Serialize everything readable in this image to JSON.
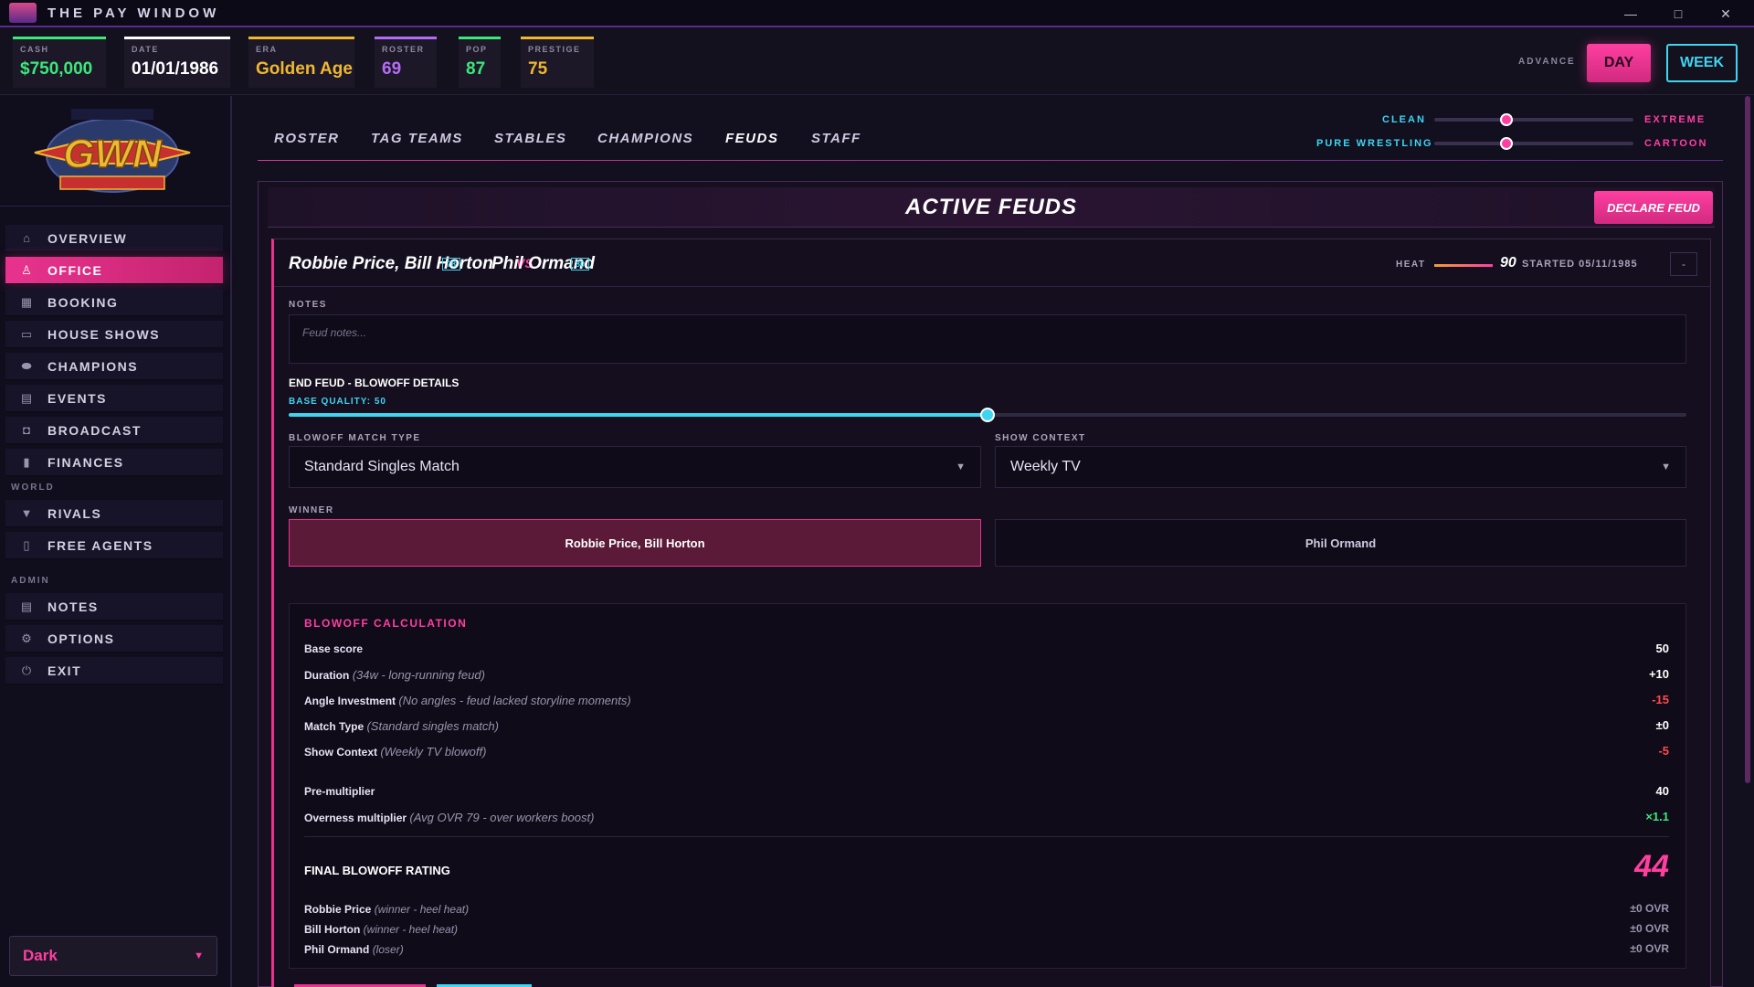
{
  "window": {
    "title": "THE PAY WINDOW",
    "minimize": "—",
    "maximize": "□",
    "close": "✕"
  },
  "stats": [
    {
      "label": "CASH",
      "value": "$750,000",
      "color": "#3ce87a"
    },
    {
      "label": "DATE",
      "value": "01/01/1986",
      "color": "#ffffff"
    },
    {
      "label": "ERA",
      "value": "Golden Age",
      "color": "#f0b830"
    },
    {
      "label": "ROSTER",
      "value": "69",
      "color": "#b56cf5"
    },
    {
      "label": "POP",
      "value": "87",
      "color": "#3ce87a"
    },
    {
      "label": "PRESTIGE",
      "value": "75",
      "color": "#f0b830"
    }
  ],
  "advance": {
    "label": "ADVANCE",
    "day": "DAY",
    "week": "WEEK"
  },
  "sidebar": {
    "items": [
      {
        "label": "OVERVIEW",
        "icon": "home-icon",
        "glyph": "⌂"
      },
      {
        "label": "OFFICE",
        "icon": "user-icon",
        "glyph": "♙",
        "active": true
      },
      {
        "label": "BOOKING",
        "icon": "calendar-icon",
        "glyph": "▦"
      },
      {
        "label": "HOUSE SHOWS",
        "icon": "ticket-icon",
        "glyph": "▭"
      },
      {
        "label": "CHAMPIONS",
        "icon": "belt-icon",
        "glyph": "⬬"
      },
      {
        "label": "EVENTS",
        "icon": "screen-icon",
        "glyph": "▤"
      },
      {
        "label": "BROADCAST",
        "icon": "camera-icon",
        "glyph": "◘"
      },
      {
        "label": "FINANCES",
        "icon": "chart-icon",
        "glyph": "▮"
      }
    ],
    "world_label": "WORLD",
    "world_items": [
      {
        "label": "RIVALS",
        "icon": "shield-icon",
        "glyph": "▼"
      },
      {
        "label": "FREE AGENTS",
        "icon": "document-icon",
        "glyph": "▯"
      }
    ],
    "admin_label": "ADMIN",
    "admin_items": [
      {
        "label": "NOTES",
        "icon": "notes-icon",
        "glyph": "▤"
      },
      {
        "label": "OPTIONS",
        "icon": "gear-icon",
        "glyph": "⚙"
      },
      {
        "label": "EXIT",
        "icon": "power-icon",
        "glyph": "⏻"
      }
    ],
    "theme": {
      "value": "Dark",
      "chevron": "▼"
    }
  },
  "tabs": [
    {
      "label": "ROSTER"
    },
    {
      "label": "TAG TEAMS"
    },
    {
      "label": "STABLES"
    },
    {
      "label": "CHAMPIONS"
    },
    {
      "label": "FEUDS",
      "active": true
    },
    {
      "label": "STAFF"
    }
  ],
  "style_sliders": [
    {
      "left": "CLEAN",
      "right": "EXTREME",
      "value": 0.33
    },
    {
      "left": "PURE WRESTLING",
      "right": "CARTOON",
      "value": 0.33
    }
  ],
  "feuds": {
    "title": "ACTIVE FEUDS",
    "declare_label": "DECLARE FEUD",
    "feud": {
      "side_a": "Robbie Price, Bill Horton",
      "side_a_ovr": "78",
      "vs": "VS",
      "side_b": "Phil Ormand",
      "side_b_ovr": "80",
      "heat_label": "HEAT",
      "heat": "90",
      "started": "STARTED 05/11/1985",
      "collapse": "-",
      "notes_label": "NOTES",
      "notes_placeholder": "Feud notes...",
      "end_title": "END FEUD - BLOWOFF DETAILS",
      "base_quality_label": "BASE QUALITY: 50",
      "base_quality": 50,
      "match_type_label": "BLOWOFF MATCH TYPE",
      "match_type": "Standard Singles Match",
      "show_context_label": "SHOW CONTEXT",
      "show_context": "Weekly TV",
      "winner_label": "WINNER",
      "winner_a": "Robbie Price, Bill Horton",
      "winner_b": "Phil Ormand",
      "calc_title": "BLOWOFF CALCULATION",
      "calc_rows": [
        {
          "key": "Base score",
          "desc": "",
          "value": "50",
          "color": "#ffffff"
        },
        {
          "key": "Duration",
          "desc": "(34w - long-running feud)",
          "value": "+10",
          "color": "#ffffff"
        },
        {
          "key": "Angle Investment",
          "desc": "(No angles - feud lacked storyline moments)",
          "value": "-15",
          "color": "#ff4a4a"
        },
        {
          "key": "Match Type",
          "desc": "(Standard singles match)",
          "value": "±0",
          "color": "#ffffff"
        },
        {
          "key": "Show Context",
          "desc": "(Weekly TV blowoff)",
          "value": "-5",
          "color": "#ff4a4a"
        }
      ],
      "pre_multiplier_label": "Pre-multiplier",
      "pre_multiplier": "40",
      "overness_label": "Overness multiplier",
      "overness_desc": "(Avg OVR 79 - over workers boost)",
      "overness": "×1.1",
      "final_label": "FINAL BLOWOFF RATING",
      "final_value": "44",
      "participants": [
        {
          "name": "Robbie Price",
          "desc": "(winner - heel heat)",
          "value": "±0 OVR"
        },
        {
          "name": "Bill Horton",
          "desc": "(winner - heel heat)",
          "value": "±0 OVR"
        },
        {
          "name": "Phil Ormand",
          "desc": "(loser)",
          "value": "±0 OVR"
        }
      ]
    }
  }
}
